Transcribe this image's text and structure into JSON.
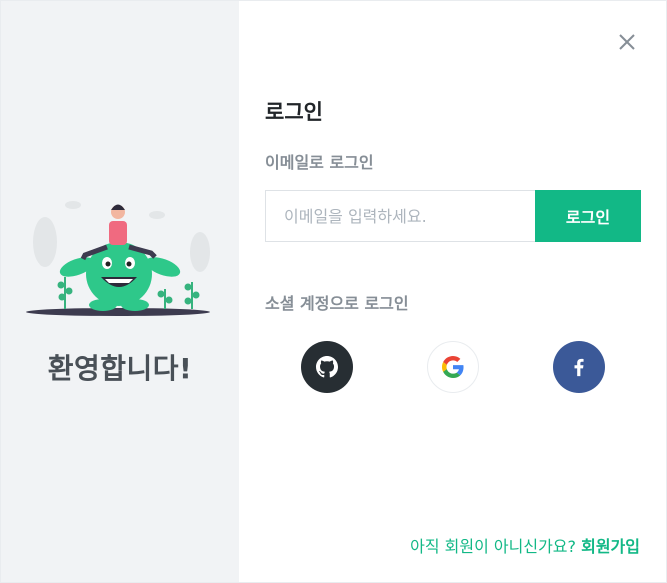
{
  "welcome": {
    "text": "환영합니다!"
  },
  "login": {
    "title": "로그인",
    "email_label": "이메일로 로그인",
    "email_placeholder": "이메일을 입력하세요.",
    "email_value": "",
    "submit_label": "로그인",
    "social_label": "소셜 계정으로 로그인",
    "social": [
      {
        "name": "github",
        "icon": "github-icon"
      },
      {
        "name": "google",
        "icon": "google-icon"
      },
      {
        "name": "facebook",
        "icon": "facebook-icon"
      }
    ]
  },
  "footer": {
    "question": "아직 회원이 아니신가요?",
    "signup": "회원가입"
  },
  "colors": {
    "accent": "#12b886",
    "github": "#272e33",
    "facebook": "#3b5998",
    "panel": "#f1f3f5"
  }
}
